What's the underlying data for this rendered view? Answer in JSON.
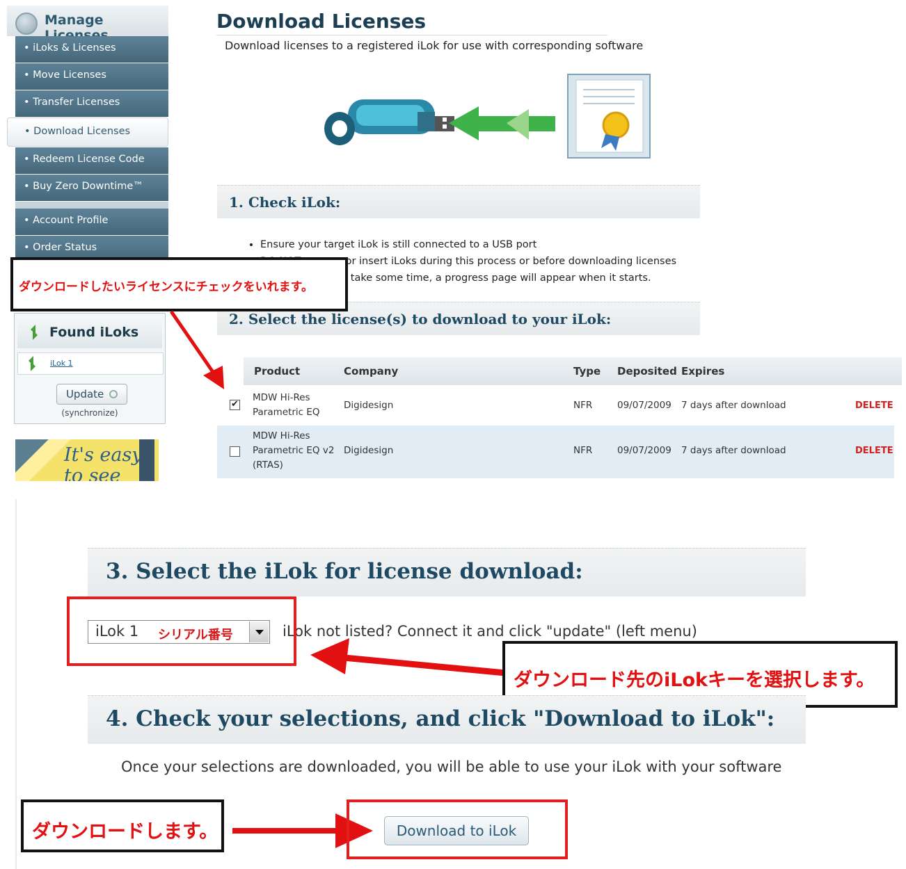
{
  "sidebar": {
    "header": "Manage Licenses",
    "items": [
      {
        "label": "• iLoks & Licenses"
      },
      {
        "label": "• Move Licenses"
      },
      {
        "label": "• Transfer Licenses"
      },
      {
        "label": "• Download Licenses",
        "active": true
      },
      {
        "label": "• Redeem License Code"
      },
      {
        "label": "• Buy Zero Downtime™"
      },
      {
        "label": "• Account Profile"
      },
      {
        "label": "• Order Status"
      }
    ],
    "found_iloks": {
      "title": "Found iLoks",
      "ilok_link": "iLok 1",
      "update_label": "Update",
      "sync_note": "(synchronize)"
    },
    "ad_text_line1": "It's easy",
    "ad_text_line2": "to see"
  },
  "main": {
    "title": "Download Licenses",
    "subtitle": "Download licenses to a registered iLok for use with corresponding software",
    "step1": {
      "title": "1. Check iLok:",
      "bullets": [
        "Ensure your target iLok is still connected to a USB port",
        "DO NOT remove or insert iLoks during this process or before downloading licenses",
        "Downloading can take some time, a progress page will appear when it starts."
      ]
    },
    "step2": {
      "title": "2. Select the license(s) to download to your iLok:",
      "columns": [
        "Product",
        "Company",
        "Type",
        "Deposited",
        "Expires"
      ],
      "rows": [
        {
          "checked": true,
          "product_line1": "MDW Hi-Res",
          "product_line2": "Parametric EQ",
          "product_line3": "",
          "company": "Digidesign",
          "type": "NFR",
          "deposited": "09/07/2009",
          "expires": "7 days after download",
          "action": "DELETE"
        },
        {
          "checked": false,
          "product_line1": "MDW Hi-Res",
          "product_line2": "Parametric EQ v2",
          "product_line3": "(RTAS)",
          "company": "Digidesign",
          "type": "NFR",
          "deposited": "09/07/2009",
          "expires": "7 days after download",
          "action": "DELETE"
        }
      ]
    },
    "step3": {
      "title": "3. Select the iLok for license download:",
      "select_value": "iLok 1",
      "select_serial": "シリアル番号",
      "hint": "iLok not listed? Connect it and click \"update\" (left menu)"
    },
    "step4": {
      "title": "4. Check your selections, and click \"Download to iLok\":",
      "info": "Once your selections are downloaded, you will be able to use your iLok with your software",
      "button_label": "Download to iLok"
    }
  },
  "annotations": {
    "check_license": "ダウンロードしたいライセンスにチェックをいれます。",
    "select_ilok": "ダウンロード先のiLokキーを選択します。",
    "download": "ダウンロードします。"
  },
  "colors": {
    "annotation_red": "#e21010",
    "nav_blue": "#4f7387",
    "title_blue": "#1c3e52",
    "delete_red": "#d32020"
  }
}
